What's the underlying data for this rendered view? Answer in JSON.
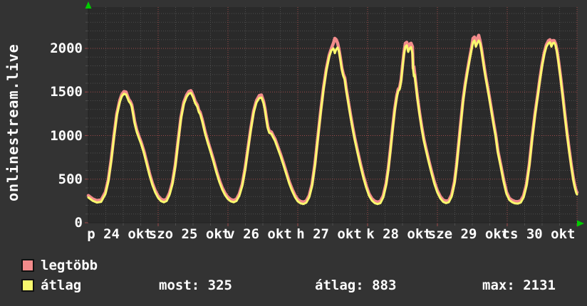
{
  "title": "onlinestream.live",
  "colors": {
    "background": "#333333",
    "plot_background": "#2a2a2a",
    "grid_minor": "#4d4d4d",
    "grid_major": "#9d4a4a",
    "axis": "#222222",
    "arrow_green": "#00cc00",
    "text": "#ffffff",
    "series_max": "#f28b8b",
    "series_avg": "#f9f96e"
  },
  "legend": {
    "max_label": "legtöbb",
    "avg_label": "átlag"
  },
  "stats": {
    "most": {
      "label": "most",
      "value": "325",
      "text": "most: 325"
    },
    "atlag": {
      "label": "átlag",
      "value": "883",
      "text": "átlag: 883"
    },
    "max": {
      "label": "max",
      "value": "2131",
      "text": "max: 2131"
    }
  },
  "chart_data": {
    "type": "line",
    "title": "onlinestream.live",
    "ylabel": "",
    "xlabel": "",
    "ylim": [
      0,
      2470
    ],
    "grid": true,
    "y_major_step": 500,
    "y_minor_step": 100,
    "y_tick_labels": [
      "0",
      "500",
      "1000",
      "1500",
      "2000"
    ],
    "y_tick_values": [
      0,
      500,
      1000,
      1500,
      2000
    ],
    "days": 7,
    "x_tick_labels": [
      "p 24 okt",
      "szo 25 okt",
      "v 26 okt",
      "h 27 okt",
      "k 28 okt",
      "sze 29 okt",
      "cs 30 okt"
    ],
    "legend_position": "bottom-left",
    "series_names": [
      "legtöbb",
      "átlag"
    ],
    "avg_points": [
      [
        0,
        290
      ],
      [
        6,
        252
      ],
      [
        12,
        232
      ],
      [
        18,
        240
      ],
      [
        24,
        330
      ],
      [
        28,
        470
      ],
      [
        32,
        700
      ],
      [
        36,
        980
      ],
      [
        40,
        1230
      ],
      [
        44,
        1380
      ],
      [
        47,
        1450
      ],
      [
        50,
        1480
      ],
      [
        53,
        1470
      ],
      [
        55,
        1430
      ],
      [
        57,
        1390
      ],
      [
        59,
        1370
      ],
      [
        61,
        1330
      ],
      [
        63,
        1240
      ],
      [
        65,
        1140
      ],
      [
        68,
        1040
      ],
      [
        71,
        970
      ],
      [
        74,
        905
      ],
      [
        78,
        800
      ],
      [
        82,
        670
      ],
      [
        86,
        540
      ],
      [
        90,
        430
      ],
      [
        94,
        345
      ],
      [
        98,
        285
      ],
      [
        102,
        248
      ],
      [
        106,
        235
      ],
      [
        110,
        250
      ],
      [
        114,
        320
      ],
      [
        118,
        440
      ],
      [
        122,
        640
      ],
      [
        126,
        920
      ],
      [
        130,
        1190
      ],
      [
        134,
        1360
      ],
      [
        138,
        1445
      ],
      [
        141,
        1480
      ],
      [
        144,
        1490
      ],
      [
        147,
        1440
      ],
      [
        150,
        1370
      ],
      [
        153,
        1330
      ],
      [
        155,
        1270
      ],
      [
        157,
        1245
      ],
      [
        160,
        1160
      ],
      [
        164,
        1020
      ],
      [
        168,
        905
      ],
      [
        172,
        800
      ],
      [
        176,
        690
      ],
      [
        180,
        570
      ],
      [
        184,
        465
      ],
      [
        188,
        380
      ],
      [
        192,
        315
      ],
      [
        196,
        270
      ],
      [
        200,
        245
      ],
      [
        204,
        235
      ],
      [
        208,
        250
      ],
      [
        212,
        310
      ],
      [
        216,
        420
      ],
      [
        220,
        600
      ],
      [
        224,
        830
      ],
      [
        228,
        1060
      ],
      [
        232,
        1260
      ],
      [
        236,
        1380
      ],
      [
        240,
        1430
      ],
      [
        243,
        1435
      ],
      [
        246,
        1370
      ],
      [
        248,
        1290
      ],
      [
        250,
        1180
      ],
      [
        252,
        1080
      ],
      [
        254,
        1030
      ],
      [
        257,
        1020
      ],
      [
        259,
        985
      ],
      [
        262,
        940
      ],
      [
        266,
        850
      ],
      [
        270,
        760
      ],
      [
        274,
        660
      ],
      [
        278,
        555
      ],
      [
        282,
        450
      ],
      [
        286,
        365
      ],
      [
        290,
        295
      ],
      [
        294,
        245
      ],
      [
        298,
        222
      ],
      [
        302,
        215
      ],
      [
        306,
        230
      ],
      [
        310,
        290
      ],
      [
        314,
        420
      ],
      [
        318,
        650
      ],
      [
        322,
        950
      ],
      [
        326,
        1250
      ],
      [
        330,
        1520
      ],
      [
        334,
        1740
      ],
      [
        338,
        1900
      ],
      [
        341,
        1975
      ],
      [
        344,
        2000
      ],
      [
        346,
        1945
      ],
      [
        348,
        1990
      ],
      [
        350,
        2010
      ],
      [
        352,
        1960
      ],
      [
        354,
        1860
      ],
      [
        356,
        1750
      ],
      [
        358,
        1680
      ],
      [
        360,
        1640
      ],
      [
        362,
        1520
      ],
      [
        365,
        1370
      ],
      [
        368,
        1220
      ],
      [
        371,
        1080
      ],
      [
        374,
        950
      ],
      [
        378,
        800
      ],
      [
        382,
        655
      ],
      [
        386,
        520
      ],
      [
        390,
        405
      ],
      [
        394,
        310
      ],
      [
        398,
        255
      ],
      [
        402,
        225
      ],
      [
        406,
        215
      ],
      [
        410,
        225
      ],
      [
        414,
        290
      ],
      [
        418,
        430
      ],
      [
        421,
        600
      ],
      [
        424,
        820
      ],
      [
        427,
        1060
      ],
      [
        430,
        1280
      ],
      [
        433,
        1440
      ],
      [
        435,
        1510
      ],
      [
        437,
        1530
      ],
      [
        439,
        1620
      ],
      [
        441,
        1780
      ],
      [
        443,
        1930
      ],
      [
        445,
        2020
      ],
      [
        447,
        2035
      ],
      [
        449,
        1960
      ],
      [
        451,
        2000
      ],
      [
        453,
        2015
      ],
      [
        455,
        1940
      ],
      [
        456,
        1750
      ],
      [
        457,
        1680
      ],
      [
        458,
        1700
      ],
      [
        460,
        1560
      ],
      [
        462,
        1420
      ],
      [
        465,
        1240
      ],
      [
        468,
        1080
      ],
      [
        471,
        940
      ],
      [
        474,
        830
      ],
      [
        478,
        690
      ],
      [
        482,
        560
      ],
      [
        486,
        440
      ],
      [
        490,
        345
      ],
      [
        494,
        280
      ],
      [
        498,
        240
      ],
      [
        502,
        225
      ],
      [
        506,
        235
      ],
      [
        510,
        300
      ],
      [
        514,
        450
      ],
      [
        517,
        650
      ],
      [
        520,
        900
      ],
      [
        523,
        1150
      ],
      [
        526,
        1390
      ],
      [
        529,
        1570
      ],
      [
        532,
        1720
      ],
      [
        535,
        1860
      ],
      [
        538,
        1990
      ],
      [
        540,
        2070
      ],
      [
        542,
        2090
      ],
      [
        544,
        2020
      ],
      [
        546,
        2060
      ],
      [
        548,
        2090
      ],
      [
        550,
        2060
      ],
      [
        552,
        1970
      ],
      [
        554,
        1860
      ],
      [
        556,
        1750
      ],
      [
        558,
        1650
      ],
      [
        560,
        1560
      ],
      [
        563,
        1420
      ],
      [
        566,
        1270
      ],
      [
        569,
        1120
      ],
      [
        572,
        980
      ],
      [
        575,
        800
      ],
      [
        579,
        640
      ],
      [
        583,
        470
      ],
      [
        587,
        330
      ],
      [
        591,
        260
      ],
      [
        595,
        235
      ],
      [
        599,
        222
      ],
      [
        603,
        220
      ],
      [
        607,
        232
      ],
      [
        611,
        290
      ],
      [
        615,
        420
      ],
      [
        619,
        650
      ],
      [
        623,
        960
      ],
      [
        627,
        1230
      ],
      [
        631,
        1460
      ],
      [
        634,
        1640
      ],
      [
        637,
        1800
      ],
      [
        640,
        1930
      ],
      [
        643,
        2020
      ],
      [
        646,
        2060
      ],
      [
        648,
        2070
      ],
      [
        650,
        2020
      ],
      [
        652,
        2060
      ],
      [
        654,
        2065
      ],
      [
        656,
        2030
      ],
      [
        658,
        1950
      ],
      [
        660,
        1840
      ],
      [
        663,
        1650
      ],
      [
        666,
        1440
      ],
      [
        669,
        1220
      ],
      [
        672,
        1010
      ],
      [
        675,
        820
      ],
      [
        678,
        640
      ],
      [
        681,
        480
      ],
      [
        683,
        400
      ],
      [
        685,
        340
      ],
      [
        686,
        325
      ]
    ],
    "max_default_offset": 22,
    "max_overrides": [
      [
        50,
        1505
      ],
      [
        53,
        1500
      ],
      [
        141,
        1505
      ],
      [
        144,
        1515
      ],
      [
        240,
        1460
      ],
      [
        243,
        1465
      ],
      [
        344,
        2060
      ],
      [
        346,
        2115
      ],
      [
        348,
        2100
      ],
      [
        350,
        2060
      ],
      [
        445,
        2060
      ],
      [
        447,
        2070
      ],
      [
        451,
        2050
      ],
      [
        453,
        2060
      ],
      [
        455,
        2020
      ],
      [
        457,
        1790
      ],
      [
        540,
        2115
      ],
      [
        542,
        2131
      ],
      [
        546,
        2110
      ],
      [
        548,
        2150
      ],
      [
        646,
        2090
      ],
      [
        648,
        2100
      ],
      [
        652,
        2090
      ],
      [
        654,
        2090
      ]
    ]
  }
}
